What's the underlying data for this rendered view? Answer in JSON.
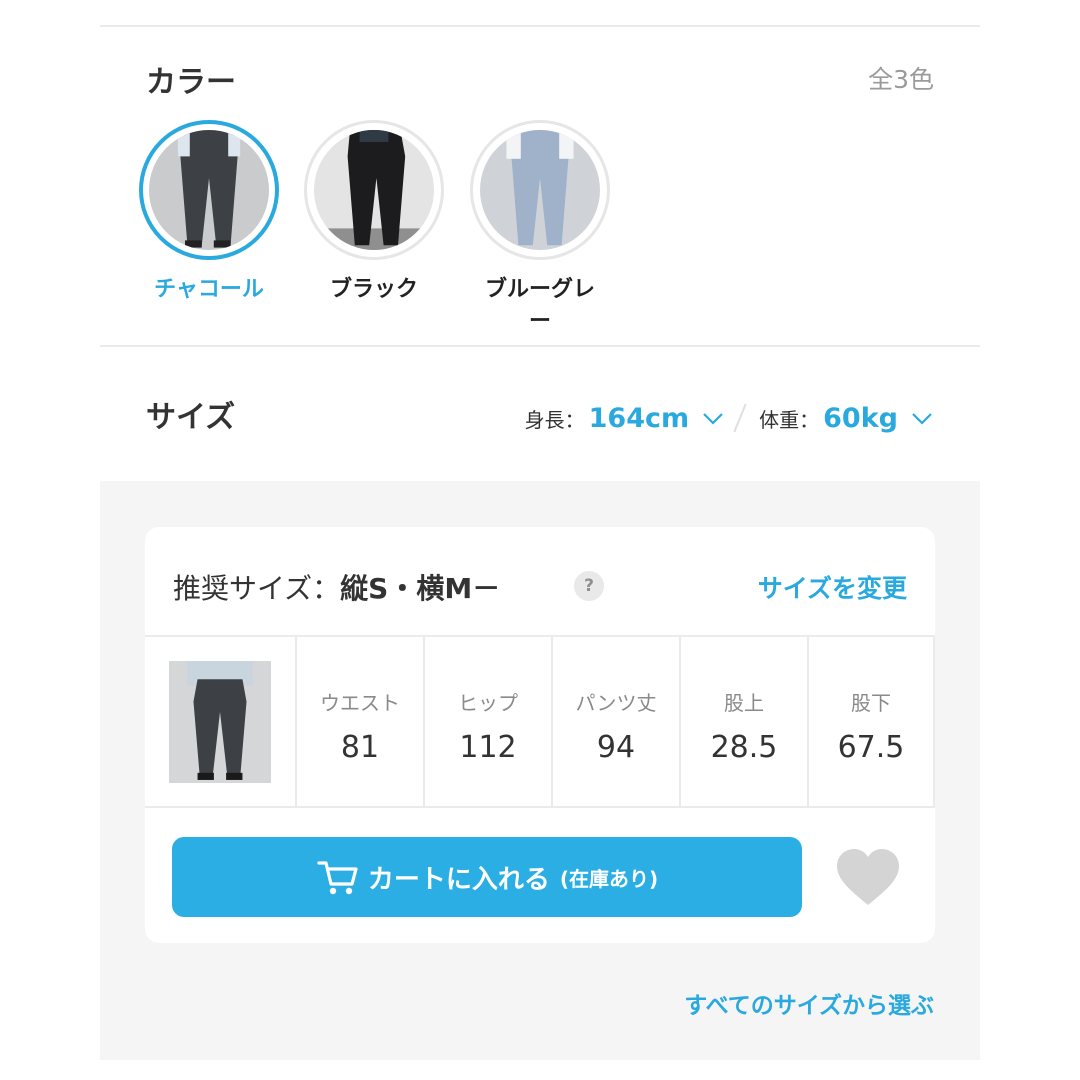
{
  "color_section": {
    "title": "カラー",
    "count": "全3色",
    "swatches": [
      {
        "label": "チャコール",
        "selected": true,
        "tone": "#3d4044"
      },
      {
        "label": "ブラック",
        "selected": false,
        "tone": "#1c1c1e"
      },
      {
        "label": "ブルーグレー",
        "selected": false,
        "tone": "#9fb2c9"
      }
    ]
  },
  "size_section": {
    "title": "サイズ",
    "height_label": "身長：",
    "height_value": "164cm",
    "weight_label": "体重：",
    "weight_value": "60kg"
  },
  "recommend": {
    "prefix": "推奨サイズ：",
    "value": "縦S・横M－",
    "help": "?",
    "change_link": "サイズを変更"
  },
  "measurements": [
    {
      "label": "ウエスト",
      "value": "81"
    },
    {
      "label": "ヒップ",
      "value": "112"
    },
    {
      "label": "パンツ丈",
      "value": "94"
    },
    {
      "label": "股上",
      "value": "28.5"
    },
    {
      "label": "股下",
      "value": "67.5"
    }
  ],
  "cart": {
    "label": "カートに入れる",
    "stock": "(在庫あり)"
  },
  "all_sizes_link": "すべてのサイズから選ぶ",
  "colors": {
    "accent": "#2aa9df",
    "button": "#2aaee3",
    "heart": "#d4d4d4",
    "panel": "#f5f5f5"
  }
}
